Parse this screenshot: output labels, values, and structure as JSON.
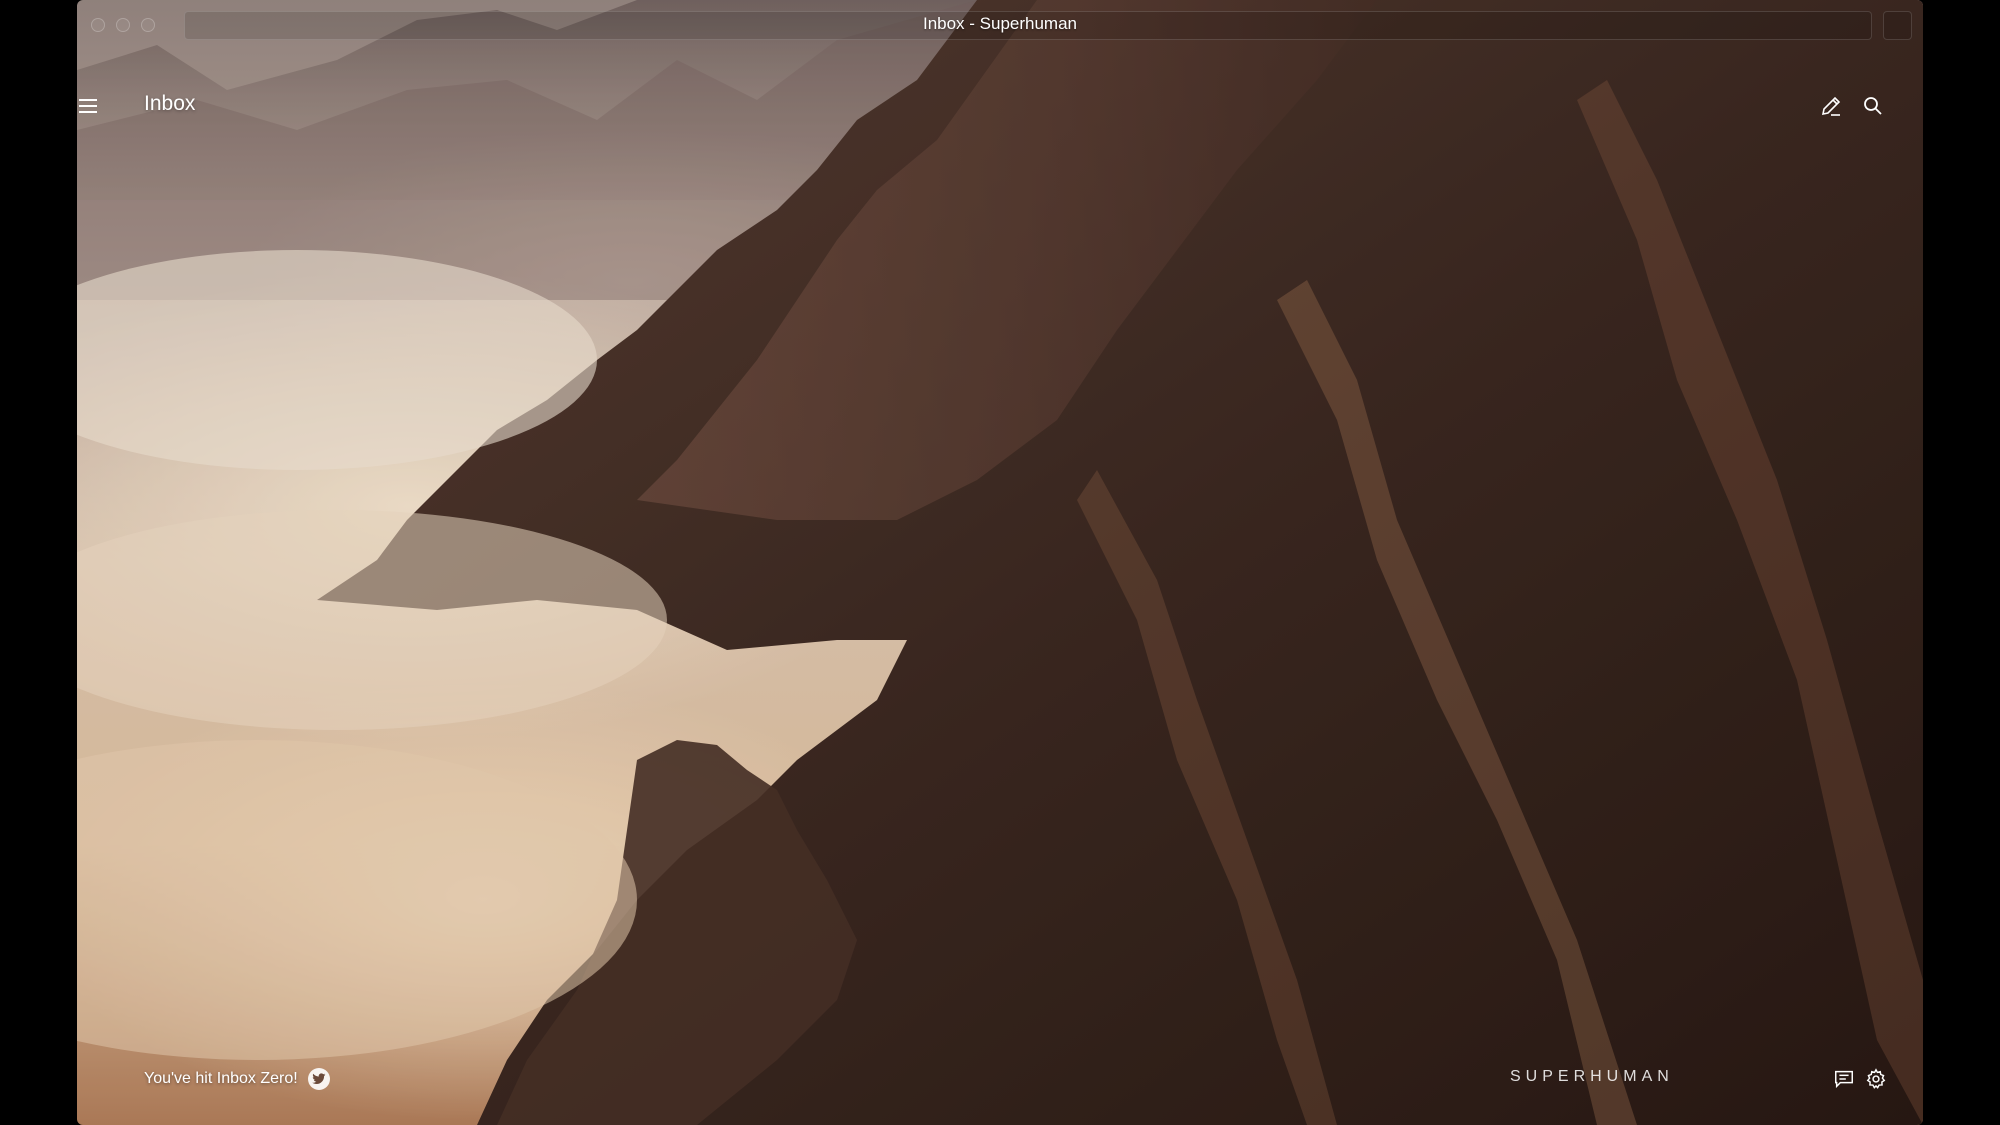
{
  "window": {
    "title": "Inbox - Superhuman"
  },
  "header": {
    "title": "Inbox",
    "icons": [
      "menu-icon",
      "compose-icon",
      "search-icon"
    ]
  },
  "footer": {
    "status_text": "You've hit Inbox Zero!",
    "brand": "SUPERHUMAN",
    "icons": [
      "twitter-icon",
      "comments-icon",
      "settings-icon"
    ]
  },
  "colors": {
    "text": "#ffffff",
    "window_background": "#000000"
  }
}
